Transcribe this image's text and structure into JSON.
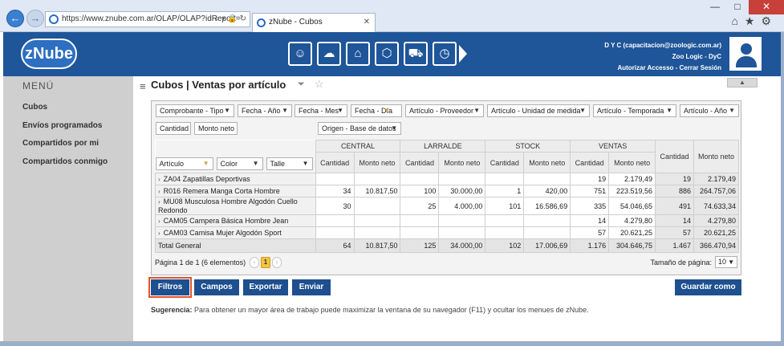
{
  "browser": {
    "url": "https://www.znube.com.ar/OLAP/OLAP?idReport=",
    "tab_title": "zNube - Cubos",
    "window": {
      "minimize": "—",
      "maximize": "□",
      "close": "✕"
    }
  },
  "header": {
    "logo_text": "zNube",
    "modules": [
      "users-icon",
      "cloud-gear-icon",
      "warehouse-icon",
      "box-icon",
      "cart-icon",
      "clock-icon"
    ],
    "user_line1": "D Y C (capacitacion@zoologic.com.ar)",
    "user_line2": "Zoo Logic - DyC",
    "user_line3": "Autorizar Accesso - Cerrar Sesión"
  },
  "sidebar": {
    "title": "MENÚ",
    "items": [
      "Cubos",
      "Envíos programados",
      "Compartidos por mi",
      "Compartidos conmigo"
    ]
  },
  "page": {
    "title": "Cubos | Ventas por artículo"
  },
  "pivot": {
    "filter_fields": [
      "Comprobante - Tipo",
      "Fecha - Año",
      "Fecha - Mes",
      "Fecha - Día",
      "Artículo - Proveedor",
      "Artículo - Unidad de medida",
      "Artículo - Temporada",
      "Artículo - Año"
    ],
    "data_fields": [
      "Cantidad",
      "Monto neto"
    ],
    "column_field": "Origen - Base de datos",
    "row_fields": [
      "Artículo",
      "Color",
      "Talle"
    ],
    "columns": [
      "CENTRAL",
      "LARRALDE",
      "STOCK",
      "VENTAS"
    ],
    "measure_labels": [
      "Cantidad",
      "Monto neto"
    ],
    "rows": [
      {
        "label": "ZA04 Zapatillas Deportivas",
        "cells": [
          "",
          "",
          "",
          "",
          "",
          "",
          "19",
          "2.179,49"
        ],
        "total": [
          "19",
          "2.179,49"
        ]
      },
      {
        "label": "R016 Remera Manga Corta Hombre",
        "cells": [
          "34",
          "10.817,50",
          "100",
          "30.000,00",
          "1",
          "420,00",
          "751",
          "223.519,56"
        ],
        "total": [
          "886",
          "264.757,06"
        ]
      },
      {
        "label": "MU08 Musculosa Hombre Algodón Cuello Redondo",
        "cells": [
          "30",
          "",
          "25",
          "4.000,00",
          "101",
          "16.586,69",
          "335",
          "54.046,65"
        ],
        "total": [
          "491",
          "74.633,34"
        ]
      },
      {
        "label": "CAM05 Campera Básica Hombre Jean",
        "cells": [
          "",
          "",
          "",
          "",
          "",
          "",
          "14",
          "4.279,80"
        ],
        "total": [
          "14",
          "4.279,80"
        ]
      },
      {
        "label": "CAM03 Camisa Mujer Algodón Sport",
        "cells": [
          "",
          "",
          "",
          "",
          "",
          "",
          "57",
          "20.621,25"
        ],
        "total": [
          "57",
          "20.621,25"
        ]
      }
    ],
    "grand_total": {
      "label": "Total General",
      "cells": [
        "64",
        "10.817,50",
        "125",
        "34.000,00",
        "102",
        "17.006,69",
        "1.176",
        "304.646,75"
      ],
      "total": [
        "1.467",
        "366.470,94"
      ]
    },
    "pager_text": "Página 1 de 1 (6 elementos)",
    "current_page": "1",
    "page_size_label": "Tamaño de página:",
    "page_size": "10"
  },
  "buttons": {
    "filtros": "Filtros",
    "campos": "Campos",
    "exportar": "Exportar",
    "enviar": "Enviar",
    "guardar": "Guardar como"
  },
  "hint": {
    "label": "Sugerencia:",
    "text": "Para obtener un mayor área de trabajo puede maximizar la ventana de su navegador (F11) y ocultar los menues de zNube."
  },
  "colors": {
    "brand": "#1f5599",
    "button": "#1e4f8f",
    "highlight": "#e0542e"
  }
}
